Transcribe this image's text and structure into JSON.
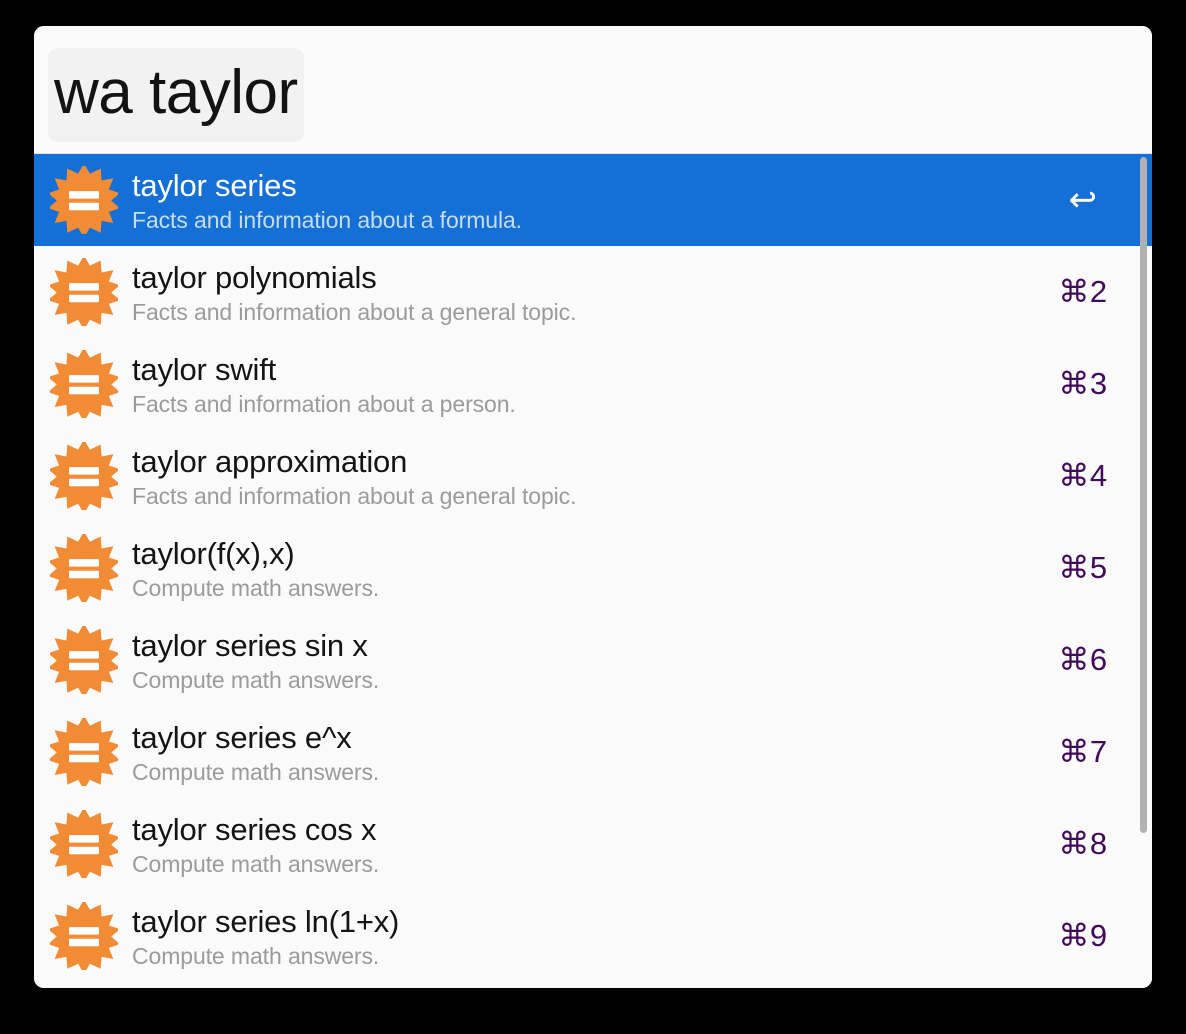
{
  "window": {
    "app_name": "alfred-launcher",
    "accent_selected_bg": "#1470d6",
    "background": "#fafafa",
    "shortcut_color": "#43095c",
    "icon_color": "#f28b35"
  },
  "search": {
    "keyword": "wa ",
    "query": "taylor",
    "full_text": "wa taylor",
    "placeholder": "Search"
  },
  "results": [
    {
      "icon": "wolfram-alpha-icon",
      "title": "taylor series",
      "subtitle": "Facts and information about a formula.",
      "hint": "↩",
      "selected": true
    },
    {
      "icon": "wolfram-alpha-icon",
      "title": "taylor polynomials",
      "subtitle": "Facts and information about a general topic.",
      "hint": "⌘2",
      "selected": false
    },
    {
      "icon": "wolfram-alpha-icon",
      "title": "taylor swift",
      "subtitle": "Facts and information about a person.",
      "hint": "⌘3",
      "selected": false
    },
    {
      "icon": "wolfram-alpha-icon",
      "title": "taylor approximation",
      "subtitle": "Facts and information about a general topic.",
      "hint": "⌘4",
      "selected": false
    },
    {
      "icon": "wolfram-alpha-icon",
      "title": "taylor(f(x),x)",
      "subtitle": "Compute math answers.",
      "hint": "⌘5",
      "selected": false
    },
    {
      "icon": "wolfram-alpha-icon",
      "title": "taylor series sin x",
      "subtitle": "Compute math answers.",
      "hint": "⌘6",
      "selected": false
    },
    {
      "icon": "wolfram-alpha-icon",
      "title": "taylor series e^x",
      "subtitle": "Compute math answers.",
      "hint": "⌘7",
      "selected": false
    },
    {
      "icon": "wolfram-alpha-icon",
      "title": "taylor series cos x",
      "subtitle": "Compute math answers.",
      "hint": "⌘8",
      "selected": false
    },
    {
      "icon": "wolfram-alpha-icon",
      "title": "taylor series ln(1+x)",
      "subtitle": "Compute math answers.",
      "hint": "⌘9",
      "selected": false
    }
  ],
  "scrollbar": {
    "name": "results-scrollbar",
    "thumb_fraction": 0.81
  }
}
